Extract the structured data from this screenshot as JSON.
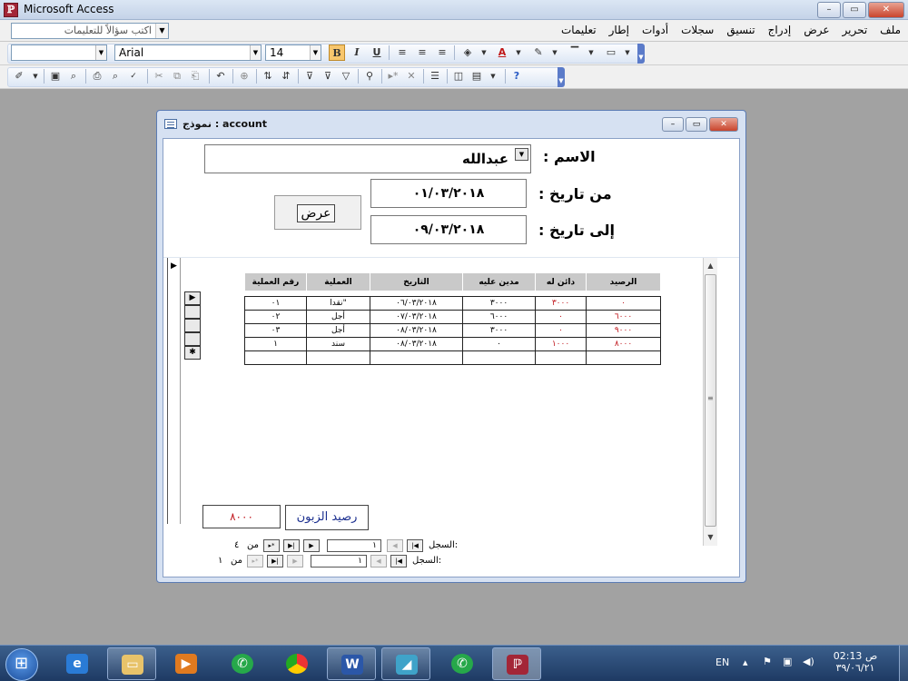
{
  "app": {
    "title": "Microsoft Access",
    "win_min": "–",
    "win_max": "▭",
    "win_close": "✕"
  },
  "menu": {
    "items": [
      "ملف",
      "تحرير",
      "عرض",
      "إدراج",
      "تنسيق",
      "سجلات",
      "أدوات",
      "إطار",
      "تعليمات"
    ],
    "ask_placeholder": "اكتب سؤالاً للتعليمات"
  },
  "toolbar": {
    "font_name": "Arial",
    "font_size": "14",
    "bold": "B",
    "italic": "I",
    "underline": "U"
  },
  "form": {
    "title": "نموذج : account",
    "name_label": "الاسم :",
    "name_value": "عبدالله",
    "from_label": "من تاريخ :",
    "from_value": "٠١/٠٣/٢٠١٨",
    "to_label": "إلى تاريخ :",
    "to_value": "٠٩/٠٣/٢٠١٨",
    "show_button": "عرض",
    "balance_label": "رصيد الزبون",
    "balance_value": "٨٠٠٠"
  },
  "grid": {
    "headers": {
      "balance": "الرصيد",
      "credit": "دائن له",
      "debit": "مدين عليه",
      "date": "التاريخ",
      "operation": "العملية",
      "number": "رقم العملية"
    },
    "rows": [
      {
        "balance": "٠",
        "credit": "٣٠٠٠",
        "debit": "٣٠٠٠",
        "date": "٠٦/٠٣/٢٠١٨",
        "operation": "نقدا\"",
        "number": "٠١"
      },
      {
        "balance": "٦٠٠٠",
        "credit": "٠",
        "debit": "٦٠٠٠",
        "date": "٠٧/٠٣/٢٠١٨",
        "operation": "أجل",
        "number": "٠٢"
      },
      {
        "balance": "٩٠٠٠",
        "credit": "٠",
        "debit": "٣٠٠٠",
        "date": "٠٨/٠٣/٢٠١٨",
        "operation": "أجل",
        "number": "٠٣"
      },
      {
        "balance": "٨٠٠٠",
        "credit": "١٠٠٠",
        "debit": "٠",
        "date": "٠٨/٠٣/٢٠١٨",
        "operation": "سند",
        "number": "١"
      }
    ]
  },
  "nav": {
    "record_label": "السجل:",
    "of_label": "من",
    "sub_current": "١",
    "sub_total": "٤",
    "main_current": "١",
    "main_total": "١"
  },
  "taskbar": {
    "lang": "EN",
    "time": "02:13 ص",
    "date": "٣٩/٠٦/٢١"
  }
}
